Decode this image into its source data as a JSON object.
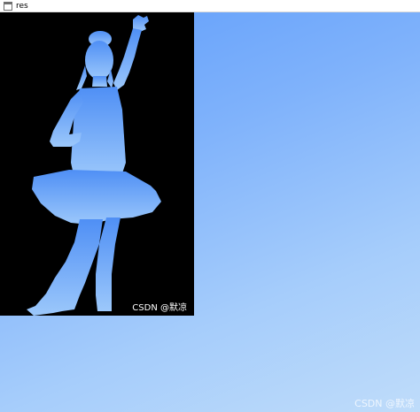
{
  "window": {
    "title": "res",
    "icon": "window-icon"
  },
  "image": {
    "watermark": "CSDN @默凉",
    "silhouette": "dancer-silhouette"
  },
  "page_watermark": "CSDN @默凉",
  "colors": {
    "panel_background": "#000000",
    "silhouette_top": "#4f8ff5",
    "silhouette_bottom": "#9cc8fb",
    "background_top_left": "#5f9dfb",
    "background_bottom_right": "#bfdcfa"
  }
}
